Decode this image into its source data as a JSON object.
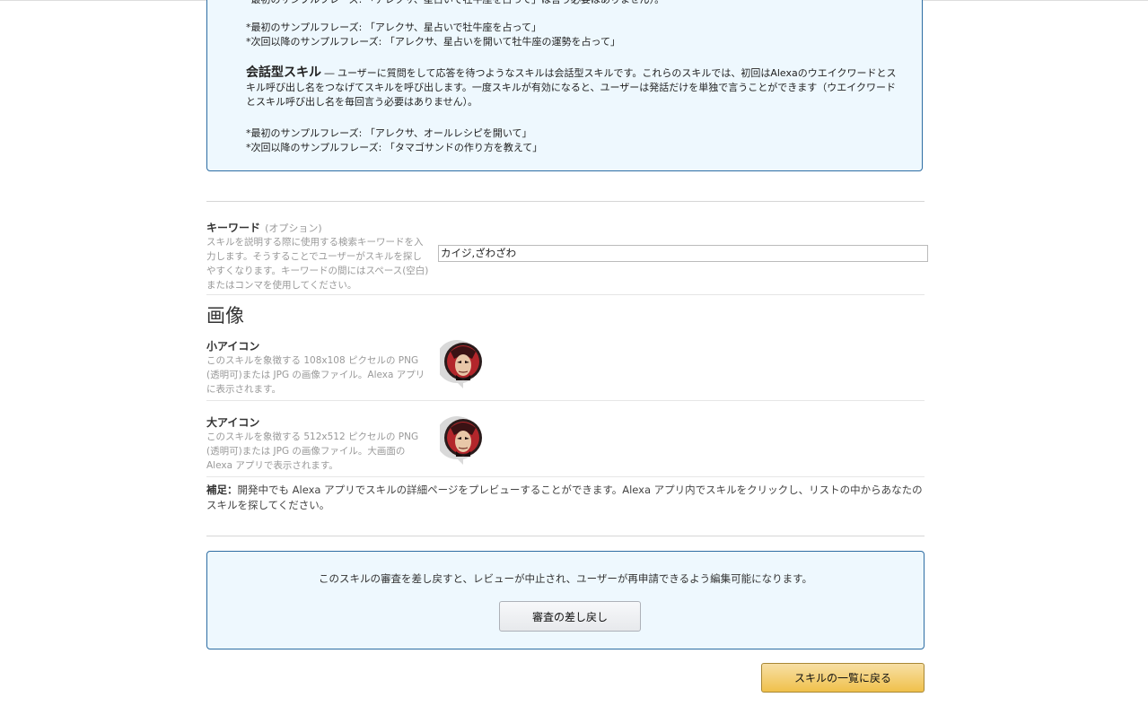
{
  "info_box": {
    "cut_line": "*最初のサンプルフレーズ: 「アレクサ、星占いで牡牛座を占って」は言う必要はありません）。",
    "oneshot_first": "*最初のサンプルフレーズ: 「アレクサ、星占いで牡牛座を占って」",
    "oneshot_next": "*次回以降のサンプルフレーズ: 「アレクサ、星占いを開いて牡牛座の運勢を占って」",
    "conversational_title": "会話型スキル",
    "conversational_body": " ― ユーザーに質問をして応答を待つようなスキルは会話型スキルです。これらのスキルでは、初回はAlexaのウエイクワードとスキル呼び出し名をつなげてスキルを呼び出します。一度スキルが有効になると、ユーザーは発話だけを単独で言うことができます（ウエイクワードとスキル呼び出し名を毎回言う必要はありません）。",
    "conv_first": "*最初のサンプルフレーズ: 「アレクサ、オールレシピを開いて」",
    "conv_next": "*次回以降のサンプルフレーズ: 「タマゴサンドの作り方を教えて」"
  },
  "keywords": {
    "label": "キーワード",
    "optional": "(オプション)",
    "description": "スキルを説明する際に使用する検索キーワードを入力します。そうすることでユーザーがスキルを探しやすくなります。キーワードの間にはスペース(空白)またはコンマを使用してください。",
    "value": "カイジ,ざわざわ"
  },
  "images": {
    "section_title": "画像",
    "small_icon": {
      "label": "小アイコン",
      "description": "このスキルを象徴する 108x108 ピクセルの PNG (透明可)または JPG の画像ファイル。Alexa アプリに表示されます。"
    },
    "large_icon": {
      "label": "大アイコン",
      "description": "このスキルを象徴する 512x512 ピクセルの PNG (透明可)または JPG の画像ファイル。大画面の Alexa アプリで表示されます。"
    }
  },
  "note": {
    "label": "補足：",
    "text": "開発中でも Alexa アプリでスキルの詳細ページをプレビューすることができます。Alexa アプリ内でスキルをクリックし、リストの中からあなたのスキルを探してください。"
  },
  "withdraw": {
    "message": "このスキルの審査を差し戻すと、レビューが中止され、ユーザーが再申請できるよう編集可能になります。",
    "button_label": "審査の差し戻し"
  },
  "back_button_label": "スキルの一覧に戻る",
  "colors": {
    "info_bg": "#eef8fe",
    "info_border": "#2d6da3",
    "primary_button": "#f0c14b"
  }
}
